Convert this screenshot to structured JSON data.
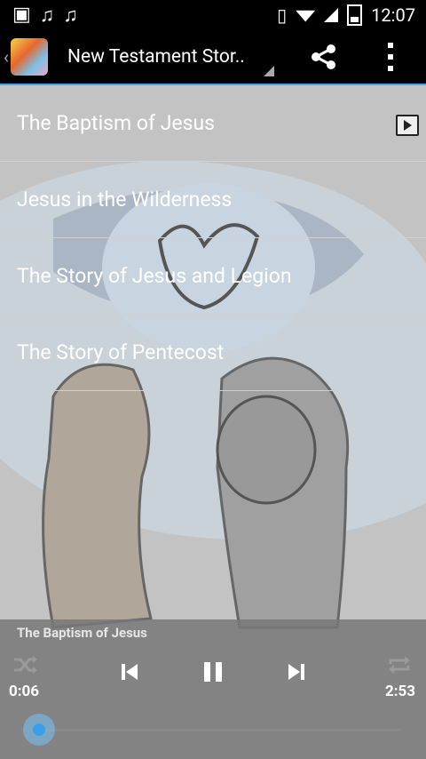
{
  "status_bar": {
    "time": "12:07",
    "left_icons": [
      "image-icon",
      "music-note-icon",
      "music-note-icon"
    ]
  },
  "action_bar": {
    "title": "New Testament Stor..",
    "icons": [
      "app-icon",
      "share-icon",
      "overflow-menu-icon"
    ]
  },
  "playlist": {
    "items": [
      {
        "title": "The Baptism of Jesus",
        "playing": true
      },
      {
        "title": "Jesus in the Wilderness",
        "playing": false
      },
      {
        "title": "The Story of Jesus and Legion",
        "playing": false
      },
      {
        "title": "The Story of Pentecost",
        "playing": false
      }
    ]
  },
  "player": {
    "now_playing": "The Baptism of Jesus",
    "current_time": "0:06",
    "duration": "2:53",
    "progress": 0.035
  },
  "colors": {
    "accent": "#4aa3e8",
    "bar": "#000000"
  }
}
